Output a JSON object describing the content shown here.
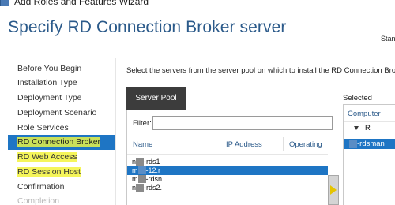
{
  "window": {
    "title": "Add Roles and Features Wizard",
    "icon": "wizard-icon"
  },
  "page": {
    "title": "Specify RD Connection Broker server",
    "destination_label": "Stanc"
  },
  "nav": {
    "items": [
      {
        "label": "Before You Begin",
        "state": "normal"
      },
      {
        "label": "Installation Type",
        "state": "normal"
      },
      {
        "label": "Deployment Type",
        "state": "normal"
      },
      {
        "label": "Deployment Scenario",
        "state": "normal"
      },
      {
        "label": "Role Services",
        "state": "normal"
      },
      {
        "label": "RD Connection Broker",
        "state": "current"
      },
      {
        "label": "RD Web Access",
        "state": "highlighted"
      },
      {
        "label": "RD Session Host",
        "state": "highlighted"
      },
      {
        "label": "Confirmation",
        "state": "normal"
      },
      {
        "label": "Completion",
        "state": "disabled"
      }
    ]
  },
  "main": {
    "instruction": "Select the servers from the server pool on which to install the RD Connection Broker",
    "server_pool": {
      "tab_label": "Server Pool",
      "filter_label": "Filter:",
      "filter_value": "",
      "columns": [
        "Name",
        "IP Address",
        "Operating"
      ],
      "rows": [
        {
          "prefix": "n",
          "suffix": "-rds1",
          "selected": false
        },
        {
          "prefix": "m",
          "suffix": "-12.r",
          "selected": true
        },
        {
          "prefix": "m",
          "suffix": "-rdsn",
          "selected": false
        },
        {
          "prefix": "n",
          "suffix": "-rds2.",
          "selected": false
        }
      ]
    },
    "add_button": {
      "icon": "arrow-right-icon"
    },
    "selected_panel": {
      "label": "Selected",
      "column": "Computer",
      "tree_domain": "R",
      "items": [
        {
          "suffix": "-rdsman",
          "selected": true
        }
      ]
    }
  },
  "colors": {
    "accent": "#1e75c4",
    "title": "#2b5a8a",
    "highlight": "#f5f55a"
  }
}
